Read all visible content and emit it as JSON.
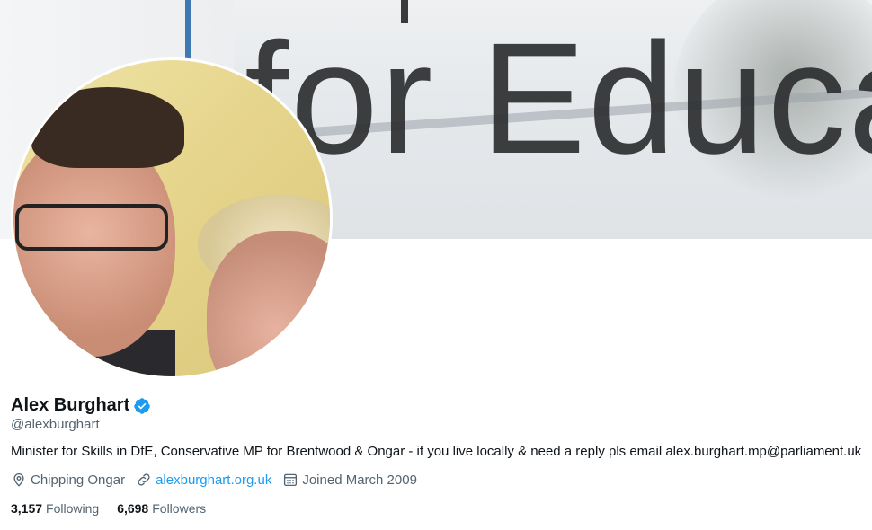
{
  "banner": {
    "text": "for Educa"
  },
  "profile": {
    "name": "Alex Burghart",
    "handle": "@alexburghart",
    "bio": "Minister for Skills in DfE, Conservative MP for Brentwood & Ongar - if you live locally & need a reply pls email alex.burghart.mp@parliament.uk",
    "location": "Chipping Ongar",
    "website": "alexburghart.org.uk",
    "joined": "Joined March 2009",
    "verified_color": "#1d9bf0"
  },
  "stats": {
    "following_count": "3,157",
    "following_label": "Following",
    "followers_count": "6,698",
    "followers_label": "Followers"
  },
  "icons": {
    "location": "location-pin-icon",
    "website": "link-icon",
    "joined": "calendar-icon",
    "verified": "verified-badge-icon"
  }
}
